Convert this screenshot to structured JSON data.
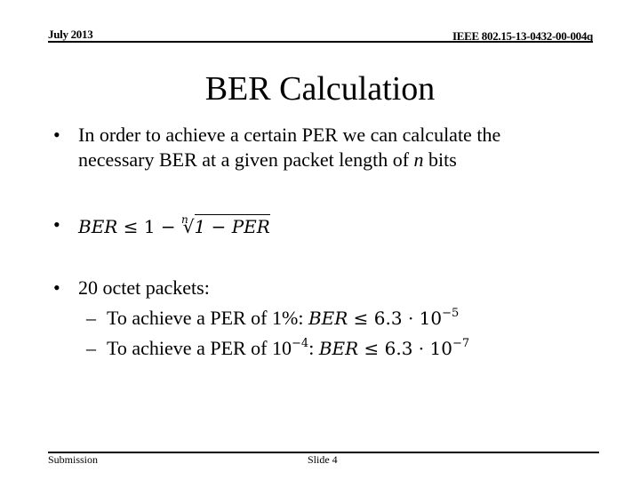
{
  "header": {
    "date": "July 2013",
    "doc_id": "IEEE 802.15-13-0432-00-004q"
  },
  "title": "BER Calculation",
  "bullets": {
    "b1": {
      "line1": "In order to achieve a certain PER we can calculate the",
      "line2_pre": "necessary BER at a given packet length of ",
      "line2_var": "n",
      "line2_post": " bits"
    },
    "b2": {
      "lhs": "BER",
      "rel": " ≤ 1 − ",
      "root_index": "n",
      "radicand": "1 − PER"
    },
    "b3": {
      "text": "20 octet packets:",
      "sub1": {
        "text": "To achieve a PER of 1%: ",
        "var": "BER",
        "rel": " ≤ 6.3 · 10",
        "exp": "−5"
      },
      "sub2": {
        "text_pre": "To achieve a PER of 10",
        "text_exp": "−4",
        "text_post": ": ",
        "var": "BER",
        "rel": " ≤ 6.3 · 10",
        "exp": "−7"
      }
    },
    "bullet_glyph": "•",
    "dash_glyph": "–"
  },
  "footer": {
    "left": "Submission",
    "center": "Slide 4"
  }
}
